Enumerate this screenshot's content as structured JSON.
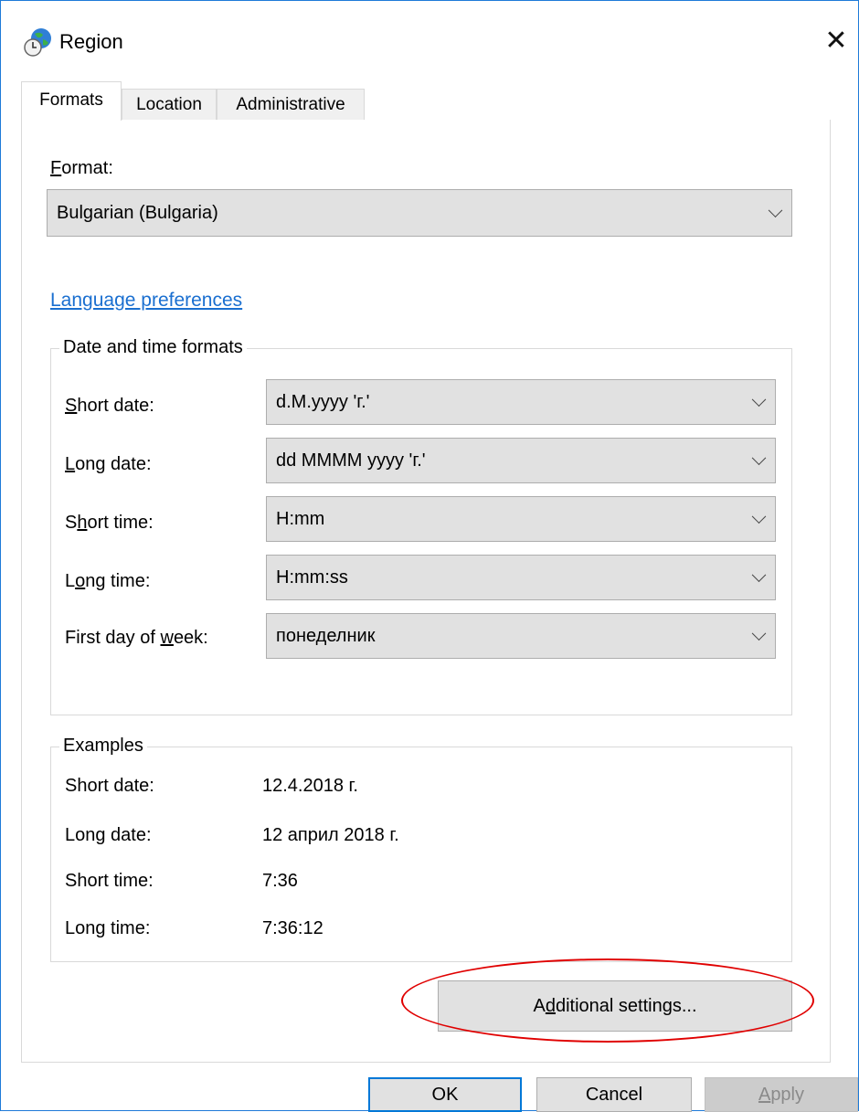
{
  "window": {
    "title": "Region",
    "icon": "globe-clock-icon",
    "close_icon": "close-icon"
  },
  "tabs": [
    {
      "label": "Formats",
      "active": true
    },
    {
      "label": "Location",
      "active": false
    },
    {
      "label": "Administrative",
      "active": false
    }
  ],
  "format": {
    "label_accel": "F",
    "label_rest": "ormat:",
    "value": "Bulgarian (Bulgaria)"
  },
  "language_link": "Language preferences",
  "date_time_group": {
    "title": "Date and time formats",
    "rows": [
      {
        "label_pre": "",
        "label_accel": "S",
        "label_post": "hort date:",
        "value": "d.M.yyyy 'г.'"
      },
      {
        "label_pre": "",
        "label_accel": "L",
        "label_post": "ong date:",
        "value": "dd MMMM yyyy 'г.'"
      },
      {
        "label_pre": "S",
        "label_accel": "h",
        "label_post": "ort time:",
        "value": "H:mm"
      },
      {
        "label_pre": "L",
        "label_accel": "o",
        "label_post": "ng time:",
        "value": "H:mm:ss"
      },
      {
        "label_pre": "First day of ",
        "label_accel": "w",
        "label_post": "eek:",
        "value": "понеделник"
      }
    ]
  },
  "examples": {
    "title": "Examples",
    "rows": [
      {
        "label": "Short date:",
        "value": "12.4.2018 г."
      },
      {
        "label": "Long date:",
        "value": "12 април 2018 г."
      },
      {
        "label": "Short time:",
        "value": "7:36"
      },
      {
        "label": "Long time:",
        "value": "7:36:12"
      }
    ]
  },
  "additional_settings": {
    "pre": "A",
    "accel": "d",
    "post": "ditional settings..."
  },
  "buttons": {
    "ok": "OK",
    "cancel": "Cancel",
    "apply_accel": "A",
    "apply_rest": "pply"
  },
  "colors": {
    "accent": "#0078d7",
    "link": "#1a6fd0",
    "highlight_oval": "#e00000"
  }
}
